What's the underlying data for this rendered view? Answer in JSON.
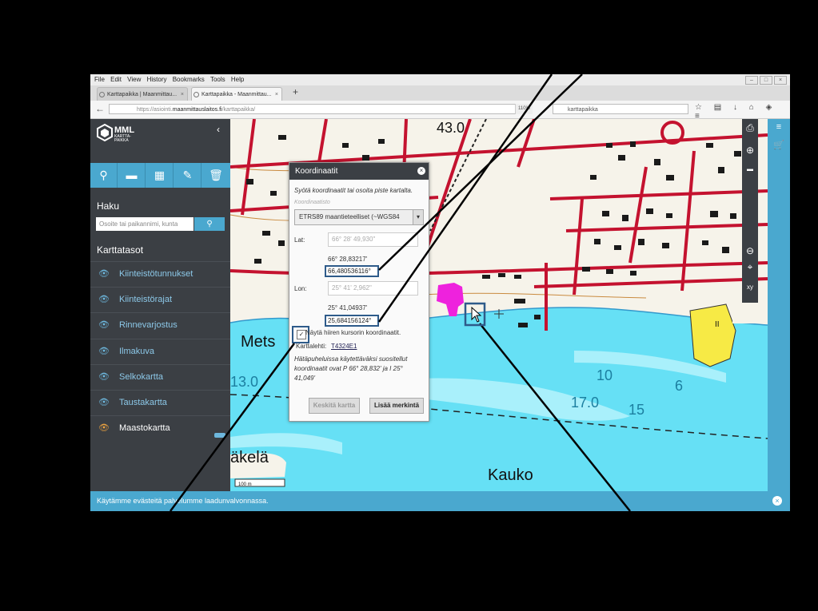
{
  "menu": [
    "File",
    "Edit",
    "View",
    "History",
    "Bookmarks",
    "Tools",
    "Help"
  ],
  "tabs": [
    {
      "label": "Karttapaikka | Maanmittau..."
    },
    {
      "label": "Karttapaikka - Maanmittau..."
    }
  ],
  "url": {
    "prefix": "https://asiointi.",
    "domain": "maanmittauslaitos.fi",
    "path": "/karttapaikka/"
  },
  "zoom": "110%",
  "search_value": "karttapaikka",
  "sidebar": {
    "logo": "MML",
    "logo_sub": "KARTTA-\nPAIKKA",
    "haku_title": "Haku",
    "search_placeholder": "Osoite tai paikannimi, kunta",
    "layers_title": "Karttatasot",
    "layers": [
      "Kiinteistötunnukset",
      "Kiinteistörajat",
      "Rinnevarjostus",
      "Ilmakuva",
      "Selkokartta",
      "Taustakartta",
      "Maastokartta"
    ]
  },
  "dialog": {
    "title": "Koordinaatit",
    "instruction": "Syötä koordinaatit tai osoita piste kartalta.",
    "system_label": "Koordinaatisto",
    "system_value": "ETRS89 maantieteelliset (~WGS84",
    "lat_label": "Lat:",
    "lat_input": "66° 28' 49,930\"",
    "lat_dm": "66° 28,83217'",
    "lat_dd": "66,480536116°",
    "lon_label": "Lon:",
    "lon_input": "25° 41' 2,962\"",
    "lon_dm": "25° 41,04937'",
    "lon_dd": "25,684156124°",
    "checkbox_label": "Näytä hiiren kursorin koordinaatit.",
    "sheet_label": "Karttalehti:",
    "sheet_value": "T4324E1",
    "emergency_text": "Hätäpuheluissa käytettäväksi suositellut koordinaatit ovat P 66° 28,832' ja I 25° 41,049'",
    "center_button": "Keskitä kartta",
    "add_button": "Lisää merkintä"
  },
  "map_labels": {
    "elev1": "43.0",
    "mets": "Mets",
    "elev2": "13.0",
    "akela": "äkelä",
    "kauko": "Kauko",
    "depth1": "10",
    "depth2": "6",
    "depth3": "17.0",
    "depth4": "15",
    "scale": "100 m",
    "ii": "II"
  },
  "cookie_text": "Käytämme evästeitä palvelumme laadunvalvonnassa.",
  "colors": {
    "accent": "#4aa8cf",
    "sidebar": "#3b3f44",
    "water": "#66e0f5",
    "road": "#c4122f"
  }
}
